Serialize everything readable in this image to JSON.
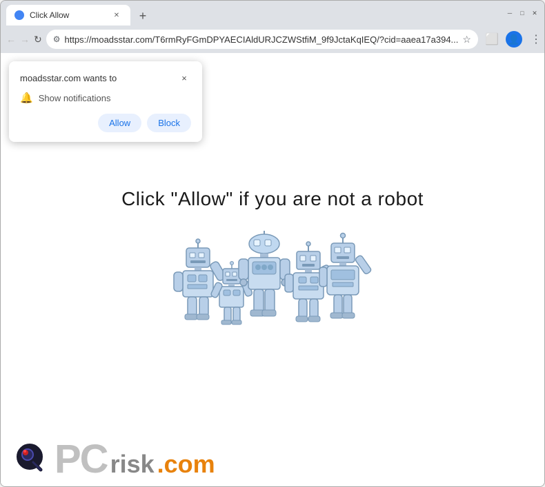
{
  "window": {
    "title": "Click Allow"
  },
  "titlebar": {
    "tab_title": "Click Allow",
    "new_tab_label": "+"
  },
  "toolbar": {
    "back_label": "←",
    "forward_label": "→",
    "reload_label": "↻",
    "url": "https://moadsstar.com/T6rmRyFGmDPYAECIAldURJCZWStfiM_9f9JctaKqIEQ/?cid=aaea17a394...",
    "menu_label": "⋮"
  },
  "popup": {
    "title": "moadsstar.com wants to",
    "close_label": "×",
    "permission_text": "Show notifications",
    "allow_label": "Allow",
    "block_label": "Block"
  },
  "page": {
    "captcha_text": "Click \"Allow\"   if you are not   a robot"
  },
  "watermark": {
    "pc_text": "PC",
    "risk_text": "risk",
    "com_text": ".com"
  }
}
